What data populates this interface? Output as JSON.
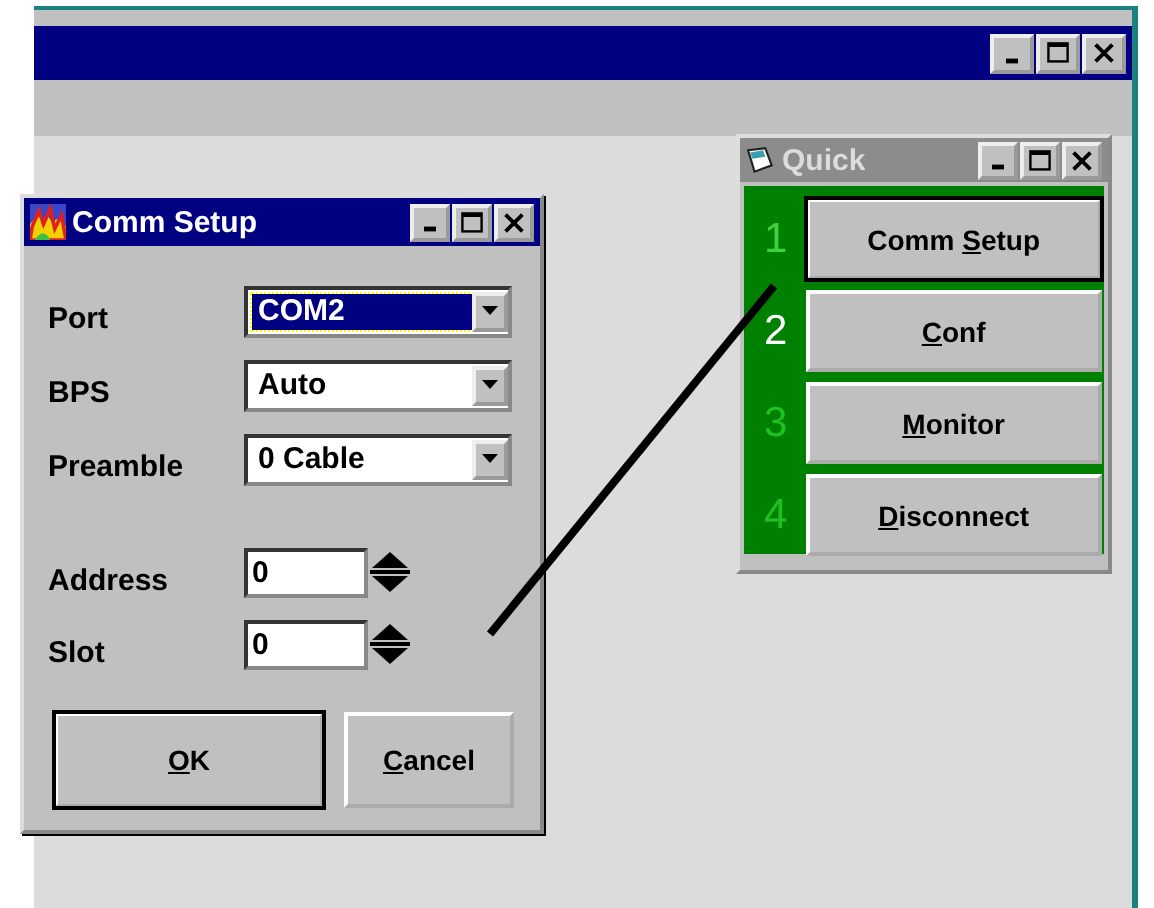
{
  "comm_setup": {
    "title": "Comm Setup",
    "active": true,
    "fields": [
      {
        "kind": "combo",
        "label": "Port",
        "value": "COM2",
        "selected": true
      },
      {
        "kind": "combo",
        "label": "BPS",
        "value": "Auto",
        "selected": false
      },
      {
        "kind": "combo",
        "label": "Preamble",
        "value": "0 Cable",
        "selected": false
      },
      {
        "kind": "spin",
        "label": "Address",
        "value": "0",
        "selected": false
      },
      {
        "kind": "spin",
        "label": "Slot",
        "value": "0",
        "selected": false
      }
    ],
    "buttons": [
      {
        "label_parts": {
          "key": "O",
          "after": "K"
        },
        "default": true
      },
      {
        "label_parts": {
          "key": "C",
          "after": "ancel"
        },
        "default": false
      }
    ]
  },
  "quick": {
    "title": "Quick",
    "active": false,
    "items": [
      {
        "number": "1",
        "highlighted": false,
        "dim": true,
        "label_parts": {
          "before": "Comm ",
          "key": "S",
          "after": "etup"
        },
        "default": true
      },
      {
        "number": "2",
        "highlighted": true,
        "dim": false,
        "label_parts": {
          "key": "C",
          "after": "onf"
        },
        "default": false
      },
      {
        "number": "3",
        "highlighted": false,
        "dim": false,
        "label_parts": {
          "key": "M",
          "after": "onitor"
        },
        "default": false
      },
      {
        "number": "4",
        "highlighted": false,
        "dim": false,
        "label_parts": {
          "key": "D",
          "after": "isconnect"
        },
        "default": false
      }
    ]
  }
}
